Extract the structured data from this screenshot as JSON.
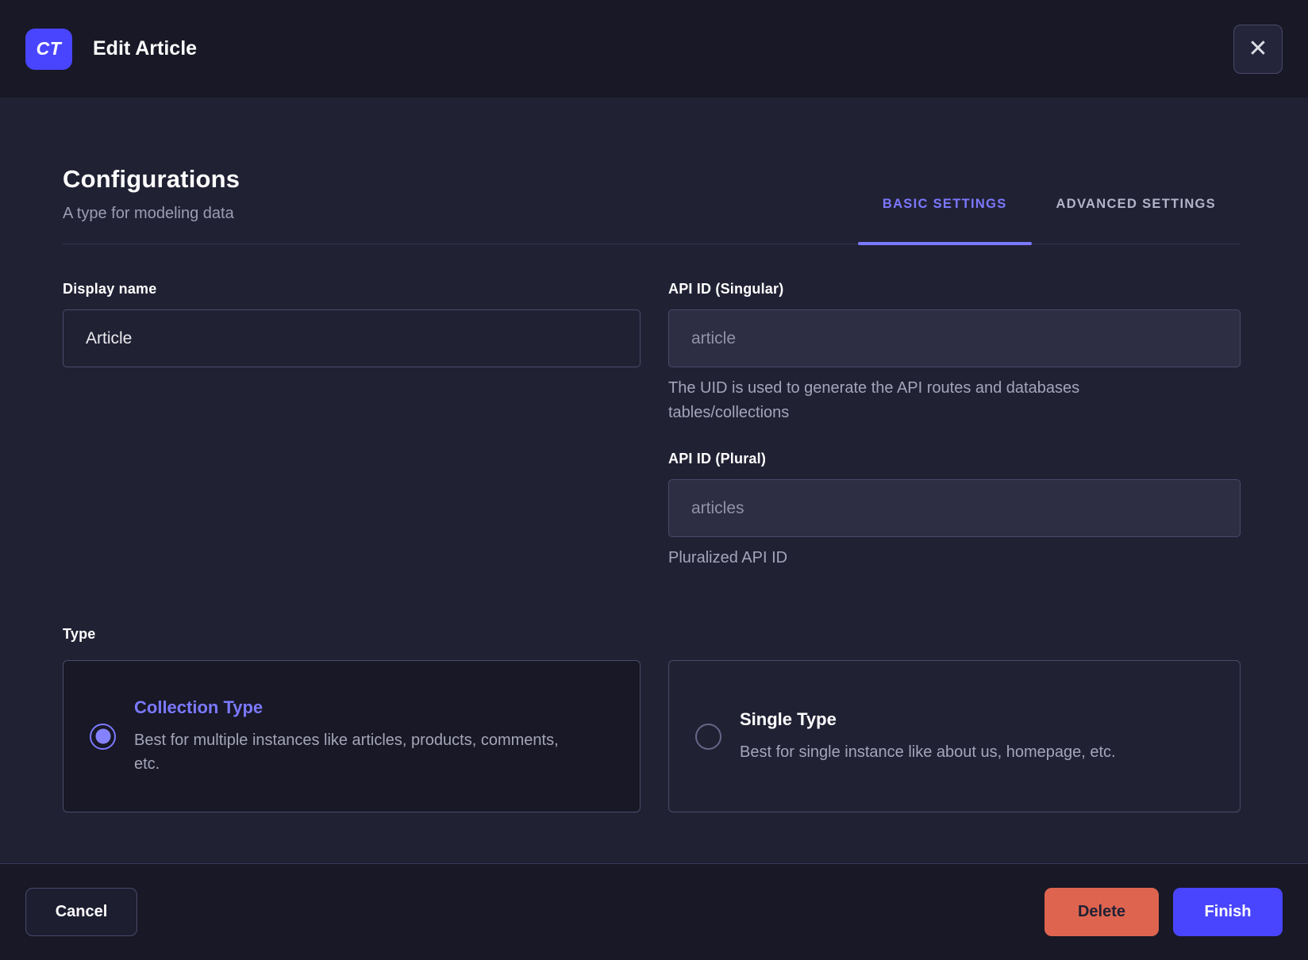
{
  "header": {
    "badge": "CT",
    "title": "Edit Article",
    "close_icon": "✕"
  },
  "section": {
    "title": "Configurations",
    "subtitle": "A type for modeling data"
  },
  "tabs": [
    {
      "label": "BASIC SETTINGS",
      "active": true
    },
    {
      "label": "ADVANCED SETTINGS",
      "active": false
    }
  ],
  "fields": {
    "display_name": {
      "label": "Display name",
      "value": "Article"
    },
    "api_singular": {
      "label": "API ID (Singular)",
      "value": "article",
      "hint": "The UID is used to generate the API routes and databases tables/collections"
    },
    "api_plural": {
      "label": "API ID (Plural)",
      "value": "articles",
      "hint": "Pluralized API ID"
    }
  },
  "type": {
    "label": "Type",
    "options": [
      {
        "title": "Collection Type",
        "description": "Best for multiple instances like articles, products, comments, etc.",
        "selected": true
      },
      {
        "title": "Single Type",
        "description": "Best for single instance like about us, homepage, etc.",
        "selected": false
      }
    ]
  },
  "footer": {
    "cancel_label": "Cancel",
    "delete_label": "Delete",
    "finish_label": "Finish"
  },
  "colors": {
    "primary": "#4945ff",
    "primary_light": "#7b79ff",
    "danger": "#de6450",
    "bg_dark": "#181826",
    "bg_body": "#212134",
    "border": "#4a4a6a",
    "text_muted": "#a5a5ba"
  }
}
